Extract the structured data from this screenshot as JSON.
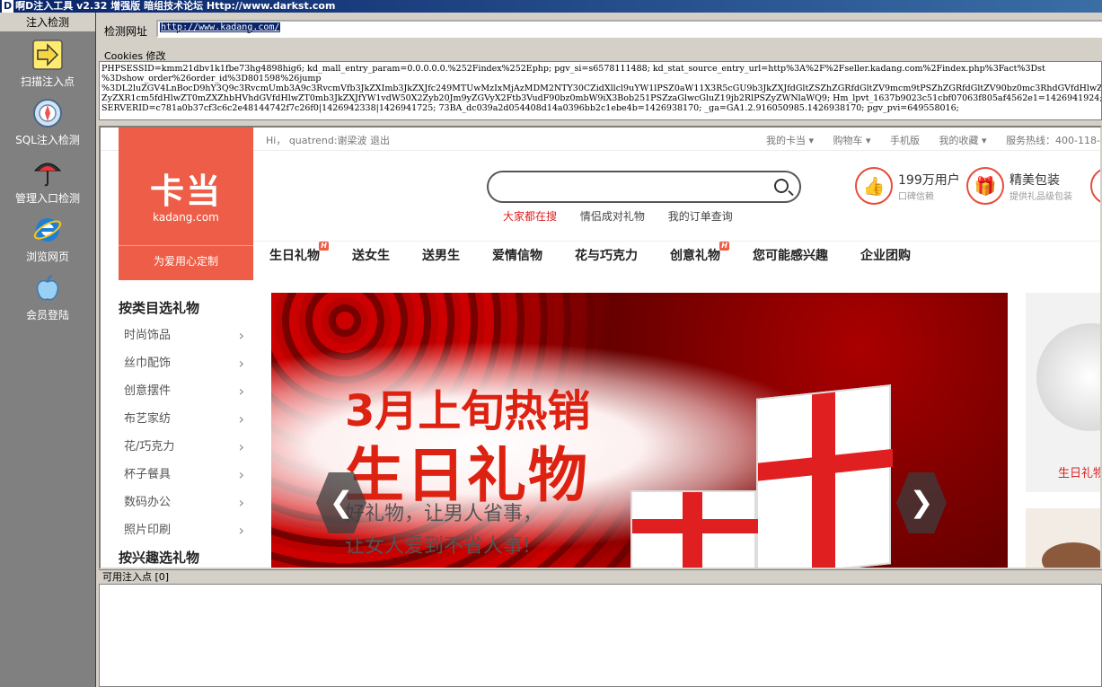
{
  "title": "啊D注入工具 v2.32 增强版 暗组技术论坛 Http://www.darkst.com",
  "title_logo": "D",
  "sidebar": {
    "header": "注入检测",
    "items": [
      {
        "label": "扫描注入点",
        "icon": "arrow-right-icon"
      },
      {
        "label": "SQL注入检测",
        "icon": "compass-icon"
      },
      {
        "label": "管理入口检测",
        "icon": "umbrella-icon"
      },
      {
        "label": "浏览网页",
        "icon": "ie-icon"
      },
      {
        "label": "会员登陆",
        "icon": "apple-icon"
      }
    ]
  },
  "url": {
    "label": "检测网址",
    "value": "http://www.kadang.com/"
  },
  "cookies": {
    "label": "Cookies 修改",
    "lines": [
      "PHPSESSID=kmm21dbv1k1fbe73hg4898hig6; kd_mall_entry_param=0.0.0.0.0.%252Findex%252Ephp; pgv_si=s6578111488; kd_stat_source_entry_url=http%3A%2F%2Fseller.kadang.com%2Findex.php%3Fact%3Dst",
      "%3Dshow_order%26order_id%3D801598%26jump",
      "%3DL2luZGV4LnBocD9hY3Q9c3RvcmUmb3A9c3RvcmVfb3JkZXImb3JkZXJfc249MTUwMzIxMjAzMDM2NTY30CZidXllcl9uYW1lPSZ0aW11X3R5cGU9b3JkZXJfdGltZSZhZGRfdGltZV9mcm9tPSZhZGRfdGltZV90bz0mc3RhdGVfdHlwZT0mb3J",
      "ZyZXR1cm5fdHlwZT0mZXZhbHVhdGVfdHlwZT0mb3JkZXJfYW1vdW50X2Zyb20Jm9yZGVyX2Ftb3VudF90bz0mbW9iX3Bob251PSZzaGlwcGluZ19jb2RlPSZyZWNlaWQ9; Hm_lpvt_1637b9023c51cbf07063f805af4562e1=1426941924; _",
      "SERVERID=c781a0b37cf3c6c2e48144742f7c26f0|1426942338|1426941725; 73BA_dc039a2d054408d14a0396bb2c1ebe4b=1426938170; _ga=GA1.2.916050985.1426938170; pgv_pvi=649558016;"
    ]
  },
  "site": {
    "topbar": {
      "hi": "Hi， quatrend:谢梁波 退出",
      "links": [
        "我的卡当 ▾",
        "购物车 ▾",
        "手机版",
        "我的收藏 ▾",
        "服务热线：400-118-"
      ]
    },
    "logo": {
      "cn": "卡当",
      "en": "kadang.com",
      "slogan": "为爱用心定制"
    },
    "search_placeholder": "",
    "hotlinks": {
      "red": "大家都在搜",
      "others": [
        "情侣成对礼物",
        "我的订单查询"
      ]
    },
    "features": [
      {
        "title": "199万用户",
        "sub": "口碑信赖",
        "icon": "thumbs-up-icon"
      },
      {
        "title": "精美包装",
        "sub": "提供礼品级包装",
        "icon": "gift-icon"
      }
    ],
    "nav": [
      {
        "label": "生日礼物",
        "hot": "H"
      },
      {
        "label": "送女生"
      },
      {
        "label": "送男生"
      },
      {
        "label": "爱情信物"
      },
      {
        "label": "花与巧克力"
      },
      {
        "label": "创意礼物",
        "hot": "H"
      },
      {
        "label": "您可能感兴趣"
      },
      {
        "label": "企业团购"
      }
    ],
    "categories": {
      "header": "按类目选礼物",
      "items": [
        "时尚饰品",
        "丝巾配饰",
        "创意摆件",
        "布艺家纺",
        "花/巧克力",
        "杯子餐具",
        "数码办公",
        "照片印刷"
      ],
      "header2": "按兴趣选礼物"
    },
    "banner": {
      "line1": "3月上旬热销",
      "line2": "生日礼物",
      "line3": "好礼物，让男人省事，",
      "line4": "让女人爱到不省人事!",
      "prev": "❮",
      "next": "❯"
    },
    "side_promo_label": "生日礼物"
  },
  "inject": {
    "label": "可用注入点 [0]"
  }
}
